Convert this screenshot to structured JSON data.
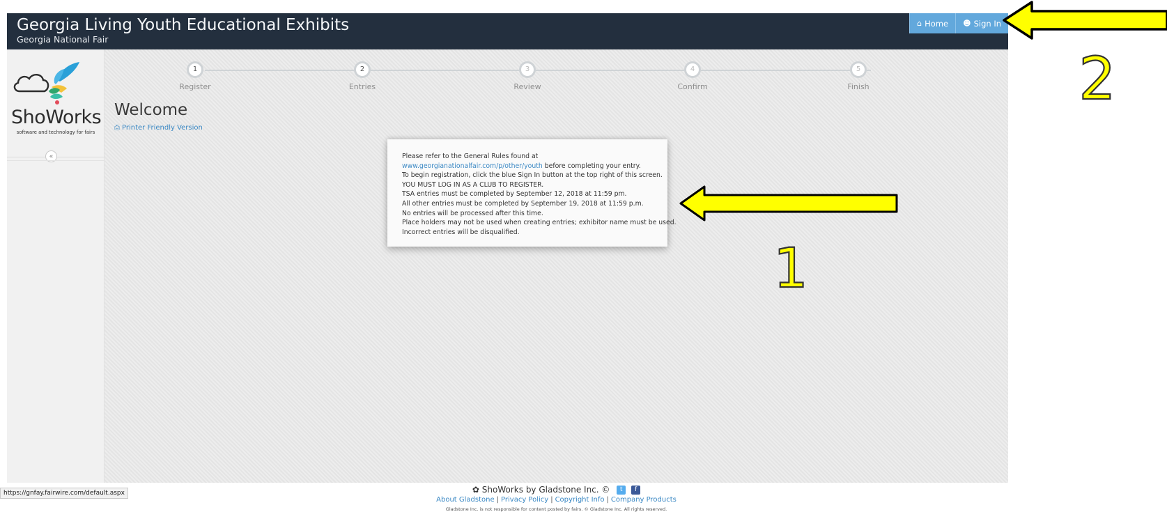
{
  "header": {
    "title": "Georgia Living Youth Educational Exhibits",
    "subtitle": "Georgia National Fair",
    "home_label": "Home",
    "signin_label": "Sign In"
  },
  "sidebar": {
    "logo_text": "ShoWorks",
    "logo_tagline": "software and technology for fairs",
    "collapse_label": "«"
  },
  "steps": [
    {
      "num": "1",
      "label": "Register"
    },
    {
      "num": "2",
      "label": "Entries"
    },
    {
      "num": "3",
      "label": "Review"
    },
    {
      "num": "4",
      "label": "Confirm"
    },
    {
      "num": "5",
      "label": "Finish"
    }
  ],
  "main": {
    "welcome": "Welcome",
    "printer_label": "Printer Friendly Version"
  },
  "notice": {
    "line1": "Please refer to the General Rules found at",
    "link": "www.georgianationalfair.com/p/other/youth",
    "line2_suffix": " before  completing  your entry.",
    "line3": "To begin registration, click the blue Sign In button at the top right of this screen.",
    "line4": "YOU MUST LOG IN AS A CLUB TO REGISTER.",
    "line5": "TSA entries must be completed by September 12, 2018 at 11:59 pm.",
    "line6": "All other entries must be completed by September 19, 2018 at 11:59 p.m.",
    "line7": "No entries will be processed after this time.",
    "line8": "Place holders may not be used when creating entries; exhibitor name must be used.",
    "line9": "Incorrect entries will be disqualified."
  },
  "footer": {
    "brand": "ShoWorks by Gladstone Inc. ©",
    "links": [
      "About Gladstone",
      "Privacy Policy",
      "Copyright Info",
      "Company Products"
    ],
    "disclaimer": "Gladstone Inc. is not responsible for content posted by fairs. © Gladstone Inc. All rights reserved."
  },
  "status_bar": {
    "url": "https://gnfay.fairwire.com/default.aspx"
  },
  "annotations": {
    "label1": "1",
    "label2": "2"
  },
  "colors": {
    "header_bg": "#232f3e",
    "button_blue": "#62a8dc",
    "link_blue": "#3a88c4",
    "arrow_yellow": "#ffff00"
  }
}
